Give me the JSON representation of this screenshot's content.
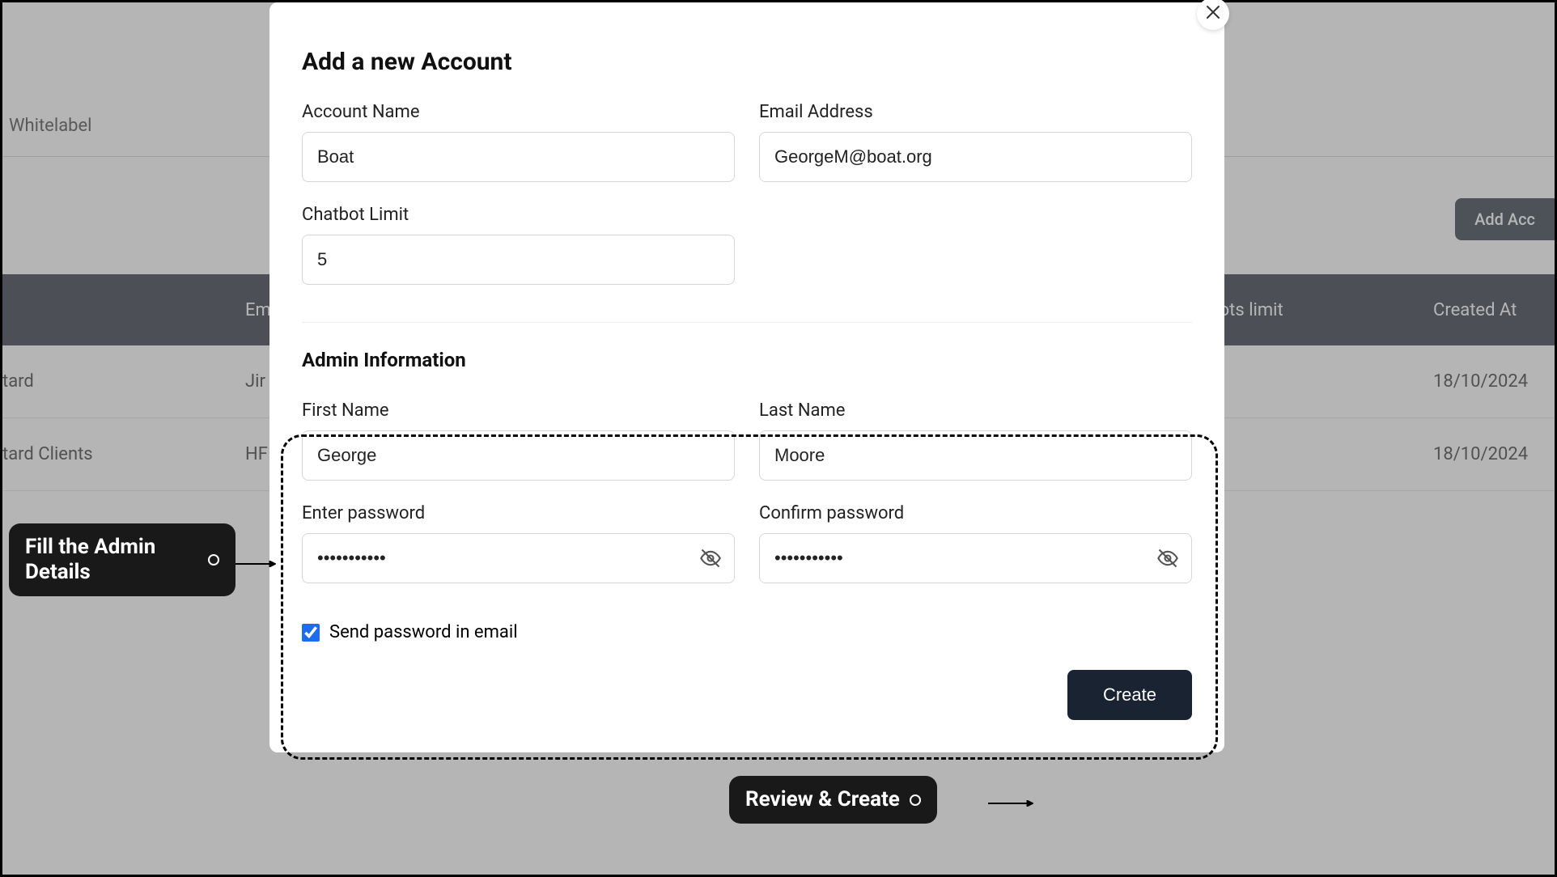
{
  "background": {
    "whitelabel_label": "Whitelabel",
    "add_account_button": "Add Acc",
    "table": {
      "headers": {
        "em": "Em",
        "chatbots_limit": "hatbots limit",
        "created_at": "Created At"
      },
      "rows": [
        {
          "name": "tard",
          "em": "Jir",
          "created_at": "18/10/2024"
        },
        {
          "name": "tard Clients",
          "em": "HF",
          "created_at": "18/10/2024"
        }
      ]
    }
  },
  "modal": {
    "title": "Add a new Account",
    "fields": {
      "account_name": {
        "label": "Account Name",
        "value": "Boat"
      },
      "email": {
        "label": "Email Address",
        "value": "GeorgeM@boat.org"
      },
      "chatbot_limit": {
        "label": "Chatbot Limit",
        "value": "5"
      }
    },
    "admin_section_title": "Admin Information",
    "admin": {
      "first_name": {
        "label": "First Name",
        "value": "George"
      },
      "last_name": {
        "label": "Last Name",
        "value": "Moore"
      },
      "password": {
        "label": "Enter password",
        "value": "•••••••••••"
      },
      "confirm_password": {
        "label": "Confirm password",
        "value": "•••••••••••"
      },
      "send_password_email": {
        "label": "Send password in email",
        "checked": true
      }
    },
    "create_button": "Create"
  },
  "annotations": {
    "admin_callout": "Fill the Admin Details",
    "review_callout": "Review & Create"
  }
}
